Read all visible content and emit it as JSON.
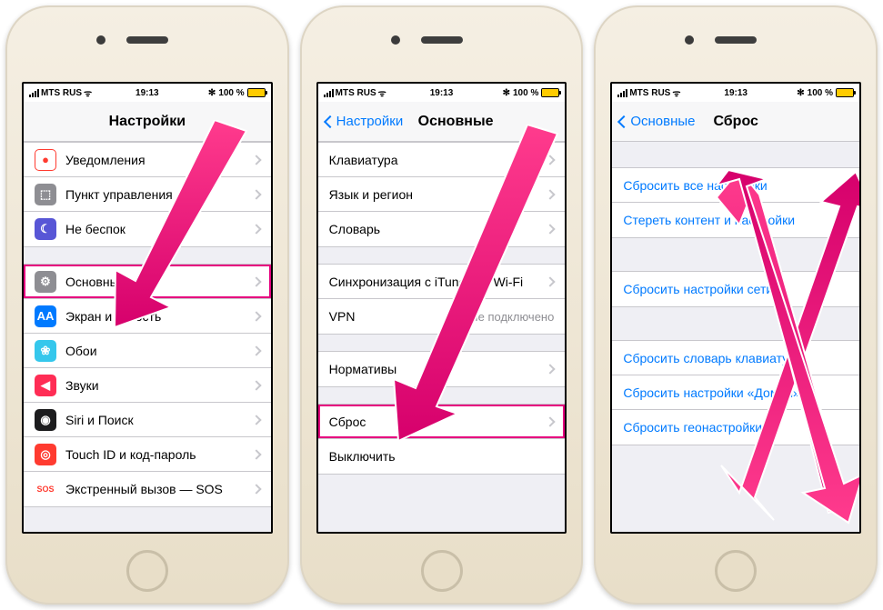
{
  "status": {
    "carrier": "MTS RUS",
    "time": "19:13",
    "bluetooth": "✻",
    "batteryPct": "100 %",
    "batteryFill": 100
  },
  "p1": {
    "title": "Настройки",
    "rows1": [
      {
        "icon": "●",
        "bg": "#ffffff",
        "border": "#ff3b30",
        "label": "Уведомления"
      },
      {
        "icon": "⬚",
        "bg": "#8e8e93",
        "label": "Пункт управления"
      },
      {
        "icon": "☾",
        "bg": "#5856d6",
        "label": "Не беспок"
      }
    ],
    "rows2": [
      {
        "icon": "⚙",
        "bg": "#8e8e93",
        "label": "Основные",
        "hl": true
      },
      {
        "icon": "AA",
        "bg": "#007aff",
        "label": "Экран и яркость"
      },
      {
        "icon": "❀",
        "bg": "#35c7ec",
        "label": "Обои"
      },
      {
        "icon": "◀",
        "bg": "#ff2d55",
        "label": "Звуки"
      },
      {
        "icon": "◉",
        "bg": "#1c1c1e",
        "label": "Siri и Поиск"
      },
      {
        "icon": "◎",
        "bg": "#ff3b30",
        "label": "Touch ID и код-пароль"
      },
      {
        "icon": "SOS",
        "bg": "#ffffff",
        "fg": "#ff3b30",
        "label": "Экстренный вызов — SOS"
      }
    ]
  },
  "p2": {
    "back": "Настройки",
    "title": "Основные",
    "rows1": [
      {
        "label": "Клавиатура"
      },
      {
        "label": "Язык и регион"
      },
      {
        "label": "Словарь"
      }
    ],
    "rows2": [
      {
        "label": "Синхронизация с iTunes по Wi-Fi"
      },
      {
        "label": "VPN",
        "value": "Не подключено",
        "noChev": true
      }
    ],
    "rows3": [
      {
        "label": "Нормативы"
      }
    ],
    "rows4": [
      {
        "label": "Сброс",
        "hl": true
      },
      {
        "label": "Выключить",
        "noChev": true
      }
    ]
  },
  "p3": {
    "back": "Основные",
    "title": "Сброс",
    "rows1": [
      {
        "label": "Сбросить все настройки",
        "link": true
      },
      {
        "label": "Стереть контент и настройки",
        "link": true
      }
    ],
    "rows2": [
      {
        "label": "Сбросить настройки сети",
        "link": true
      }
    ],
    "rows3": [
      {
        "label": "Сбросить словарь клавиатуры",
        "link": true
      },
      {
        "label": "Сбросить настройки «Домой»",
        "link": true
      },
      {
        "label": "Сбросить геонастройки",
        "link": true
      }
    ]
  }
}
